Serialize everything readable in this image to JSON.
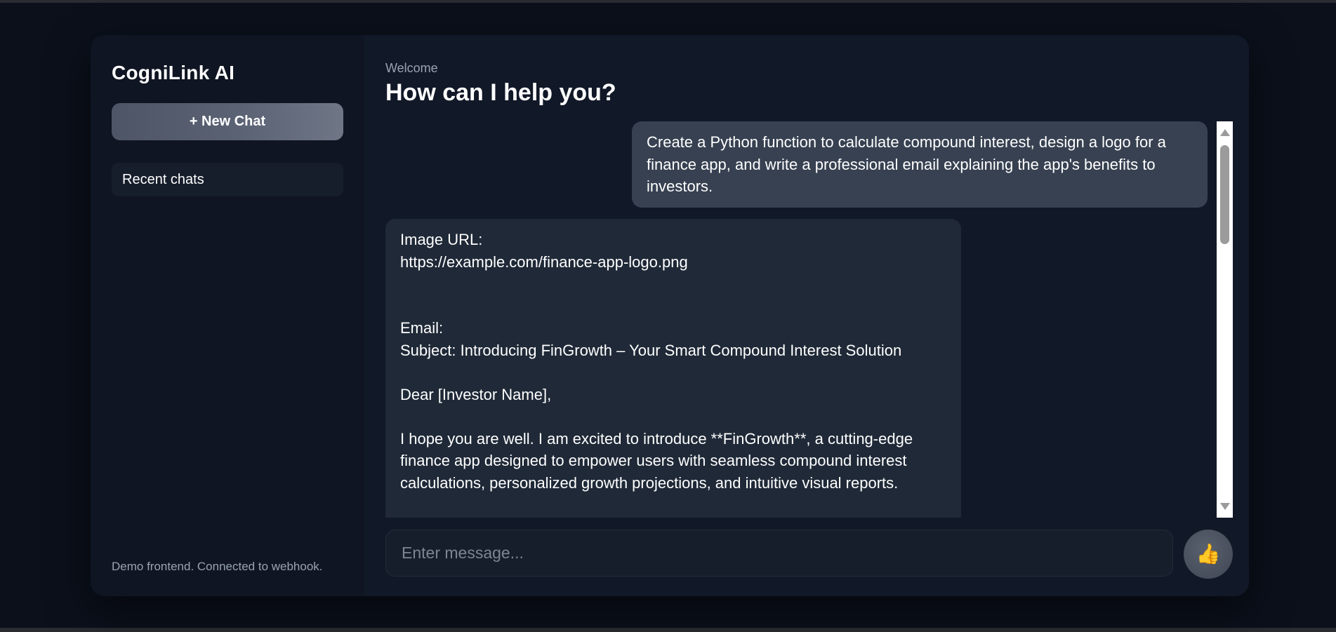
{
  "sidebar": {
    "brand": "CogniLink AI",
    "new_chat_label": "+ New Chat",
    "recent_label": "Recent chats",
    "footnote": "Demo frontend. Connected to webhook."
  },
  "main": {
    "welcome": "Welcome",
    "headline": "How can I help you?"
  },
  "messages": [
    {
      "role": "user",
      "text": "Create a Python function to calculate compound interest, design a logo for a finance app, and write a professional email explaining the app's benefits to investors."
    },
    {
      "role": "assistant",
      "text": "Image URL:\nhttps://example.com/finance-app-logo.png\n\n\nEmail:\nSubject: Introducing FinGrowth – Your Smart Compound Interest Solution\n\nDear [Investor Name],\n\nI hope you are well. I am excited to introduce **FinGrowth**, a cutting-edge finance app designed to empower users with seamless compound interest calculations, personalized growth projections, and intuitive visual reports."
    }
  ],
  "composer": {
    "placeholder": "Enter message...",
    "send_icon": "👍"
  },
  "colors": {
    "page_bg": "#0b101b",
    "app_bg": "#111827",
    "sidebar_bg": "#0f1522",
    "user_bubble": "#374151",
    "assistant_bubble": "#1f2937"
  }
}
